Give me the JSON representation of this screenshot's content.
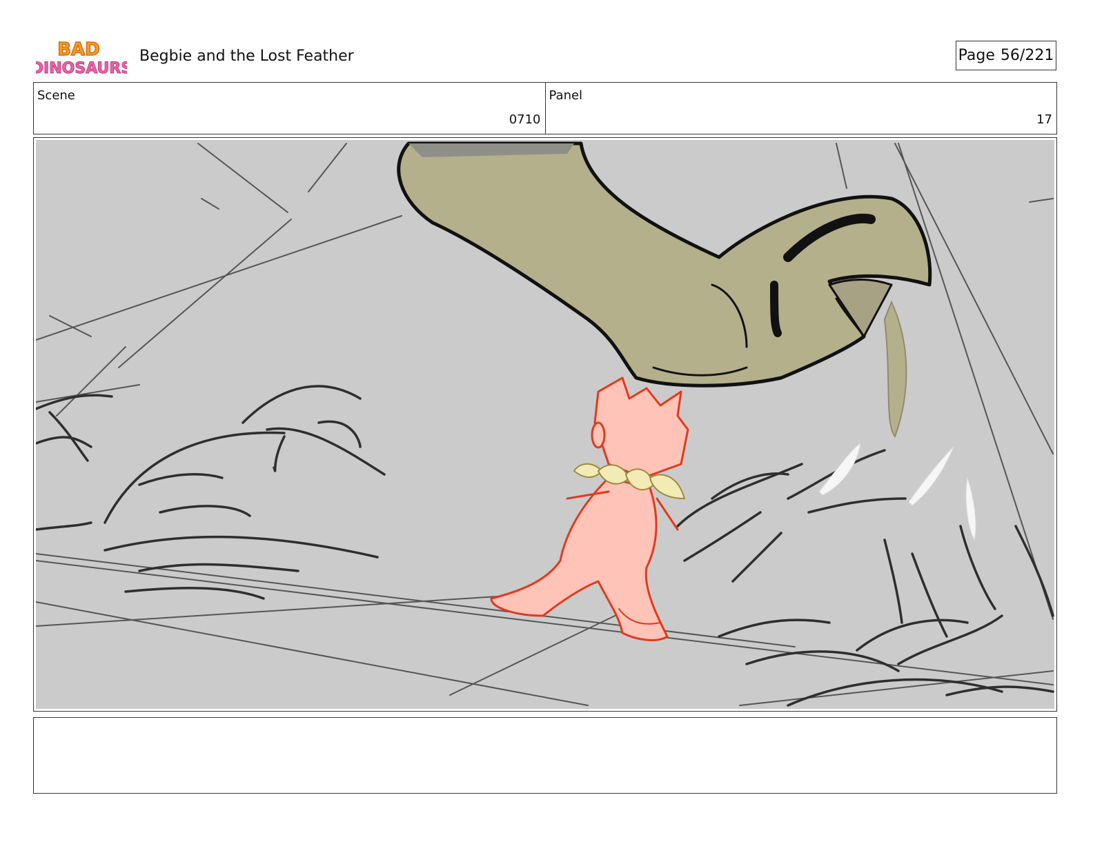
{
  "header": {
    "logo_text_top": "BAD",
    "logo_text_bottom": "DINOSAURS",
    "title": "Begbie and the Lost Feather",
    "page_label": "Page",
    "page_value": "56/221"
  },
  "meta": {
    "scene_label": "Scene",
    "scene_value": "0710",
    "panel_label": "Panel",
    "panel_value": "17"
  },
  "notes": {
    "text": ""
  },
  "colors": {
    "panel_background": "#cbcbcb",
    "sketch_lines": "#333333",
    "dinosaur_foot": "#b4b08c",
    "character_fill": "#ffc3b8",
    "character_line": "#e2391c",
    "collar": "#f3ebb5"
  }
}
